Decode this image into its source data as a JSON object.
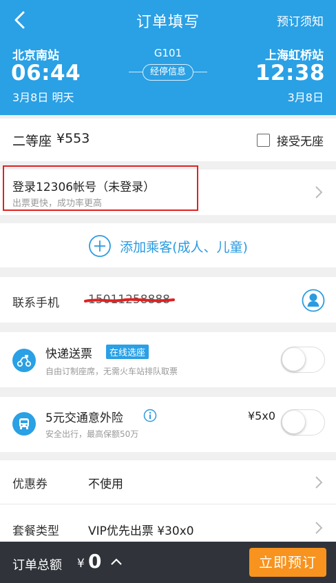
{
  "nav": {
    "title": "订单填写",
    "notice": "预订须知"
  },
  "trip": {
    "from_station": "北京南站",
    "from_time": "06:44",
    "from_date": "3月8日 明天",
    "train_no": "G101",
    "stops_label": "经停信息",
    "to_station": "上海虹桥站",
    "to_time": "12:38",
    "to_date": "3月8日"
  },
  "seat": {
    "label": "二等座",
    "price": "¥553",
    "no_seat_label": "接受无座"
  },
  "login": {
    "title": "登录12306帐号（未登录）",
    "subtitle": "出票更快，成功率更高"
  },
  "passenger": {
    "add_label": "添加乘客(成人、儿童)"
  },
  "contact": {
    "label": "联系手机",
    "value": "15011258888"
  },
  "shipping": {
    "title": "快递送票",
    "tag": "在线选座",
    "subtitle": "自由订制座席，无需火车站排队取票"
  },
  "insurance": {
    "title": "5元交通意外险",
    "subtitle": "安全出行，最高保额50万",
    "price": "¥5x0"
  },
  "coupon": {
    "label": "优惠券",
    "value": "不使用"
  },
  "package": {
    "label": "套餐类型",
    "value": "VIP优先出票 ¥30x0"
  },
  "footer": {
    "total_label": "订单总额",
    "currency": "¥",
    "total_value": "0",
    "book_label": "立即预订"
  },
  "colors": {
    "brand": "#2aa0e5",
    "accent": "#f7931e",
    "highlight": "#e02020"
  }
}
